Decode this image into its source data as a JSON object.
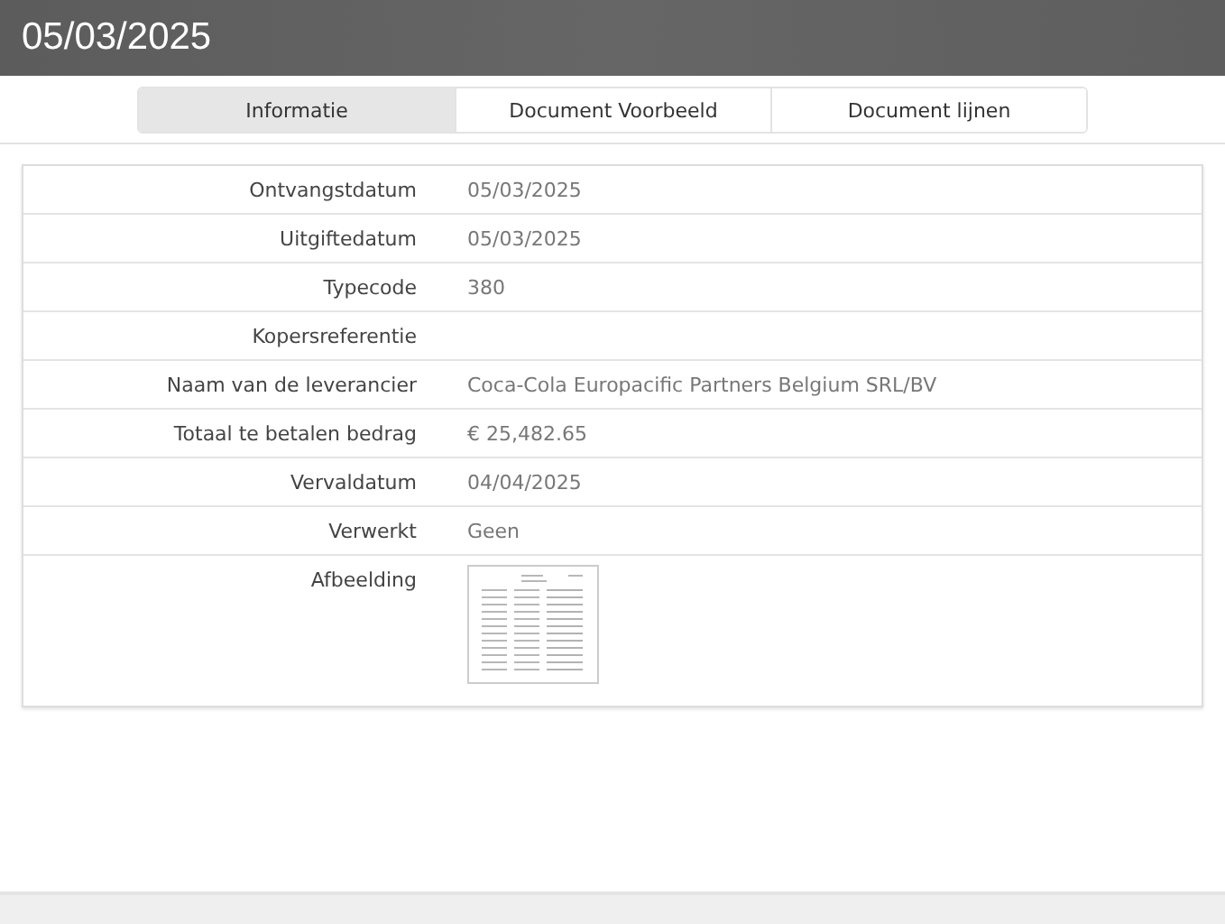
{
  "header": {
    "title": "05/03/2025"
  },
  "tabs": [
    {
      "label": "Informatie",
      "selected": true
    },
    {
      "label": "Document Voorbeeld",
      "selected": false
    },
    {
      "label": "Document lijnen",
      "selected": false
    }
  ],
  "fields": [
    {
      "kind": "text",
      "label": "Ontvangstdatum",
      "value": "05/03/2025"
    },
    {
      "kind": "text",
      "label": "Uitgiftedatum",
      "value": "05/03/2025"
    },
    {
      "kind": "text",
      "label": "Typecode",
      "value": "380"
    },
    {
      "kind": "text",
      "label": "Kopersreferentie"
    },
    {
      "kind": "text",
      "label": "Naam van de leverancier",
      "value": "Coca-Cola Europacific Partners Belgium SRL/BV"
    },
    {
      "kind": "text",
      "label": "Totaal te betalen bedrag",
      "value": "€ 25,482.65"
    },
    {
      "kind": "text",
      "label": "Vervaldatum",
      "value": "04/04/2025"
    },
    {
      "kind": "text",
      "label": "Verwerkt",
      "value": "Geen"
    },
    {
      "kind": "image",
      "label": "Afbeelding"
    }
  ]
}
